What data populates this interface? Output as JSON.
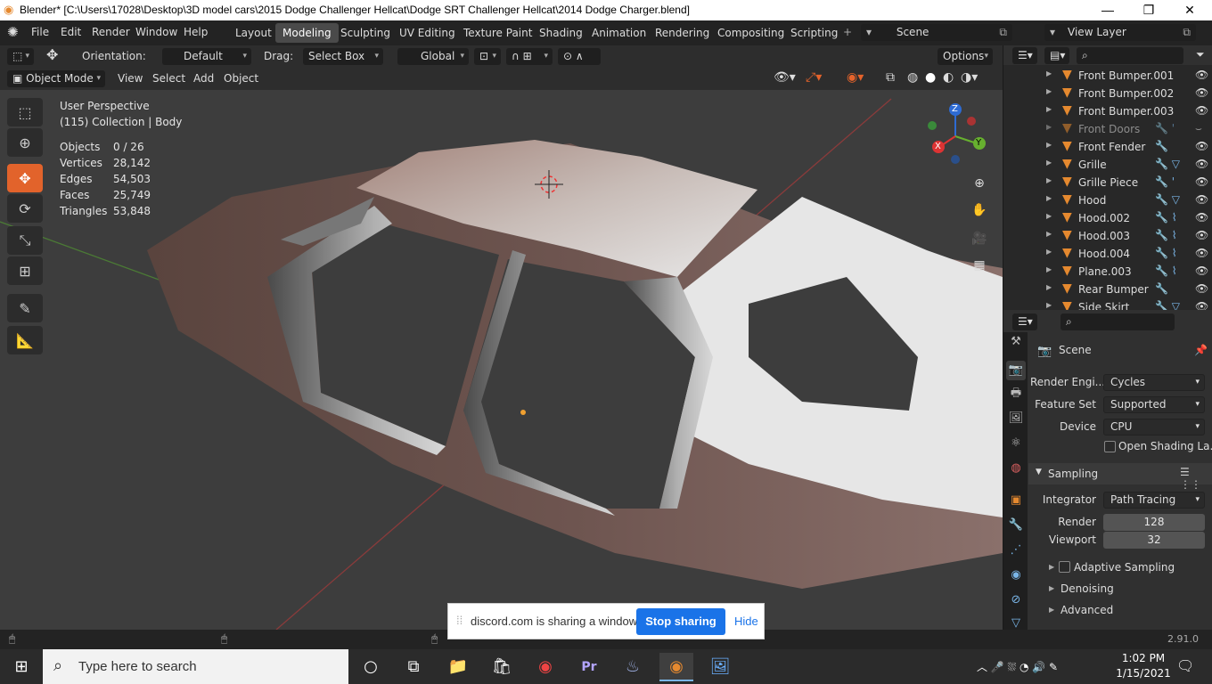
{
  "window": {
    "title": "Blender* [C:\\Users\\17028\\Desktop\\3D model cars\\2015 Dodge Challenger Hellcat\\Dodge SRT Challenger Hellcat\\2014 Dodge Charger.blend]",
    "minimize": "—",
    "maximize": "❐",
    "close": "✕"
  },
  "menu": [
    "File",
    "Edit",
    "Render",
    "Window",
    "Help"
  ],
  "workspaces": [
    "Layout",
    "Modeling",
    "Sculpting",
    "UV Editing",
    "Texture Paint",
    "Shading",
    "Animation",
    "Rendering",
    "Compositing",
    "Scripting"
  ],
  "active_workspace": "Modeling",
  "scene": "Scene",
  "view_layer": "View Layer",
  "tool_header": {
    "orientation_label": "Orientation:",
    "orientation_value": "Default",
    "drag_label": "Drag:",
    "drag_value": "Select Box",
    "transform_value": "Global",
    "options": "Options"
  },
  "viewport_header": {
    "mode": "Object Mode",
    "menus": [
      "View",
      "Select",
      "Add",
      "Object"
    ]
  },
  "overlay": {
    "perspective": "User Perspective",
    "collection": "(115) Collection | Body"
  },
  "stats": [
    {
      "k": "Objects",
      "v": "0 / 26"
    },
    {
      "k": "Vertices",
      "v": "28,142"
    },
    {
      "k": "Edges",
      "v": "54,503"
    },
    {
      "k": "Faces",
      "v": "25,749"
    },
    {
      "k": "Triangles",
      "v": "53,848"
    }
  ],
  "gizmo": {
    "z": "Z",
    "y": "Y",
    "x": "X"
  },
  "outliner": [
    {
      "name": "Front Bumper.001",
      "mods": "",
      "dim": false
    },
    {
      "name": "Front Bumper.002",
      "mods": "",
      "dim": false
    },
    {
      "name": "Front Bumper.003",
      "mods": "",
      "dim": false
    },
    {
      "name": "Front Doors",
      "mods": "🔧 '",
      "dim": true
    },
    {
      "name": "Front Fender",
      "mods": "🔧",
      "dim": false
    },
    {
      "name": "Grille",
      "mods": "🔧 ▽",
      "dim": false
    },
    {
      "name": "Grille Piece",
      "mods": "🔧 '",
      "dim": false
    },
    {
      "name": "Hood",
      "mods": "🔧 ▽",
      "dim": false
    },
    {
      "name": "Hood.002",
      "mods": "🔧 ⌇",
      "dim": false
    },
    {
      "name": "Hood.003",
      "mods": "🔧 ⌇",
      "dim": false
    },
    {
      "name": "Hood.004",
      "mods": "🔧 ⌇",
      "dim": false
    },
    {
      "name": "Plane.003",
      "mods": "🔧 ⌇",
      "dim": false
    },
    {
      "name": "Rear Bumper",
      "mods": "🔧",
      "dim": false
    },
    {
      "name": "Side Skirt",
      "mods": "🔧 ▽",
      "dim": false
    }
  ],
  "properties": {
    "context": "Scene",
    "render_engine_label": "Render Engi...",
    "render_engine": "Cycles",
    "feature_set_label": "Feature Set",
    "feature_set": "Supported",
    "device_label": "Device",
    "device": "CPU",
    "open_shading": "Open Shading La...",
    "sampling": "Sampling",
    "integrator_label": "Integrator",
    "integrator": "Path Tracing",
    "render_label": "Render",
    "render_samples": "128",
    "viewport_label": "Viewport",
    "viewport_samples": "32",
    "adaptive": "Adaptive Sampling",
    "denoising": "Denoising",
    "advanced": "Advanced"
  },
  "status": {
    "version": "2.91.0"
  },
  "share": {
    "text": "discord.com is sharing a window.",
    "stop": "Stop sharing",
    "hide": "Hide"
  },
  "taskbar": {
    "search_placeholder": "Type here to search",
    "time": "1:02 PM",
    "date": "1/15/2021"
  }
}
